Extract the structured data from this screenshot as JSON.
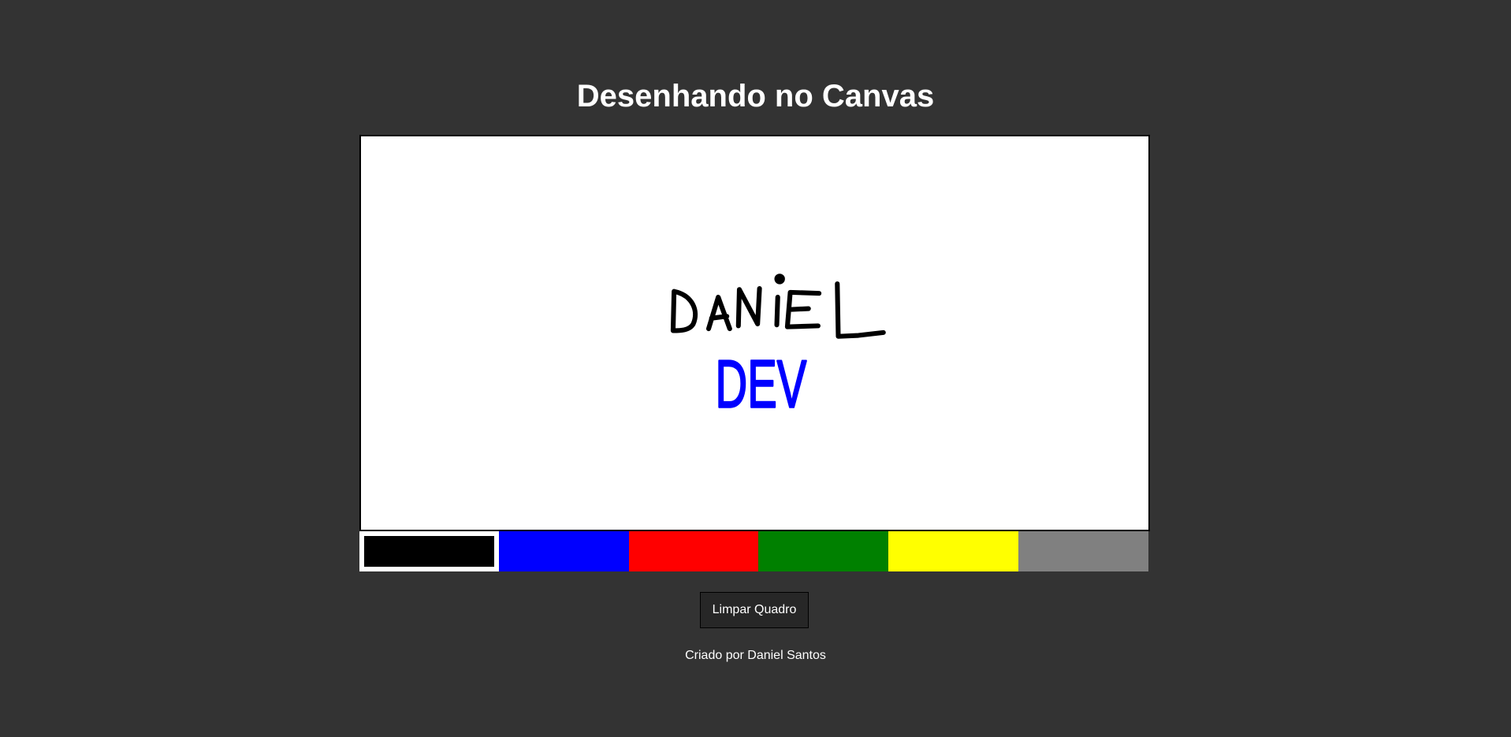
{
  "header": {
    "title": "Desenhando no Canvas"
  },
  "canvas": {
    "strokes": [
      {
        "color": "#000000",
        "label": "DANIEL"
      },
      {
        "color": "#0000ff",
        "label": "DEV"
      }
    ]
  },
  "palette": {
    "colors": [
      {
        "name": "black",
        "hex": "#000000",
        "selected": true
      },
      {
        "name": "blue",
        "hex": "#0000ff"
      },
      {
        "name": "red",
        "hex": "#ff0000"
      },
      {
        "name": "green",
        "hex": "#008000"
      },
      {
        "name": "yellow",
        "hex": "#ffff00"
      },
      {
        "name": "gray",
        "hex": "#808080"
      }
    ]
  },
  "actions": {
    "clear_label": "Limpar Quadro"
  },
  "footer": {
    "credit": "Criado por Daniel Santos"
  }
}
